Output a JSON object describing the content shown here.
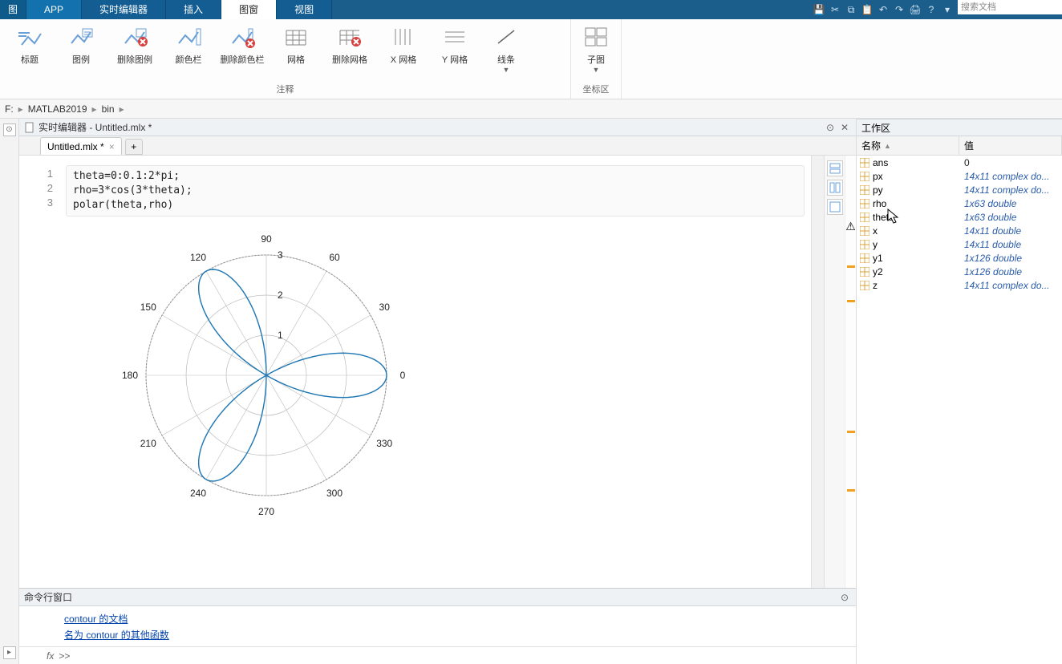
{
  "tabs": {
    "t0": "图",
    "t1": "APP",
    "t2": "实时编辑器",
    "t3": "插入",
    "t4": "图窗",
    "t5": "视图"
  },
  "search_placeholder": "搜索文档",
  "ribbon": {
    "group1": {
      "name": "注释",
      "b1": "标题",
      "b2": "图例",
      "b3": "删除图例",
      "b4": "颜色栏",
      "b5": "删除颜色栏",
      "b6": "网格",
      "b7": "删除网格",
      "b8": "X 网格",
      "b9": "Y 网格",
      "b10": "线条"
    },
    "group2": {
      "name": "坐标区",
      "b1": "子图"
    }
  },
  "breadcrumb": {
    "seg0": "F:",
    "seg1": "MATLAB2019",
    "seg2": "bin"
  },
  "editor": {
    "panel_title": "实时编辑器 - Untitled.mlx *",
    "file_tab": "Untitled.mlx *",
    "lines": [
      "1",
      "2",
      "3"
    ],
    "code": "theta=0:0.1:2*pi;\nrho=3*cos(3*theta);\npolar(theta,rho)"
  },
  "chart_data": {
    "type": "polar",
    "title": "",
    "theta_expr": "0:0.1:2*pi",
    "rho_expr": "3*cos(3*theta)",
    "r_ticks": [
      1,
      2,
      3
    ],
    "angle_ticks_deg": [
      0,
      30,
      60,
      90,
      120,
      150,
      180,
      210,
      240,
      270,
      300,
      330
    ],
    "angle_labels": [
      "0",
      "30",
      "60",
      "90",
      "120",
      "150",
      "180",
      "210",
      "240",
      "270",
      "300",
      "330"
    ],
    "rmax": 3,
    "series": [
      {
        "name": "rho",
        "color": "#1f77b4"
      }
    ]
  },
  "cmdwin": {
    "title": "命令行窗口",
    "link1_pre": "contour",
    "link1_post": " 的文档",
    "link2_pre": "名为 ",
    "link2_mid": "contour",
    "link2_post": " 的其他函数",
    "prompt": ">>"
  },
  "workspace": {
    "title": "工作区",
    "col1": "名称",
    "col2": "值",
    "rows": [
      {
        "name": "ans",
        "value": "0",
        "plain": true
      },
      {
        "name": "px",
        "value": "14x11 complex do..."
      },
      {
        "name": "py",
        "value": "14x11 complex do..."
      },
      {
        "name": "rho",
        "value": "1x63 double"
      },
      {
        "name": "theta",
        "value": "1x63 double"
      },
      {
        "name": "x",
        "value": "14x11 double"
      },
      {
        "name": "y",
        "value": "14x11 double"
      },
      {
        "name": "y1",
        "value": "1x126 double"
      },
      {
        "name": "y2",
        "value": "1x126 double"
      },
      {
        "name": "z",
        "value": "14x11 complex do..."
      }
    ]
  }
}
